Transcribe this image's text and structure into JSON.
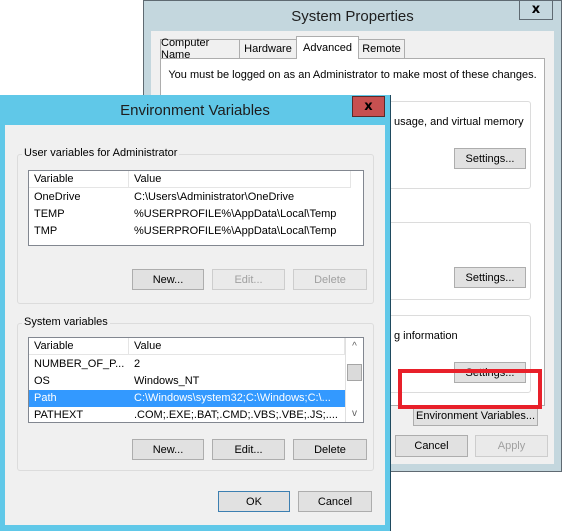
{
  "system_properties": {
    "title": "System Properties",
    "close_glyph": "x",
    "tabs": [
      {
        "label": "Computer Name",
        "active": false
      },
      {
        "label": "Hardware",
        "active": false
      },
      {
        "label": "Advanced",
        "active": true
      },
      {
        "label": "Remote",
        "active": false
      }
    ],
    "admin_note": "You must be logged on as an Administrator to make most of these changes.",
    "performance_text": "usage, and virtual memory",
    "startup_text": "g information",
    "settings_label": "Settings...",
    "env_vars_label": "Environment Variables...",
    "cancel_label": "Cancel",
    "apply_label": "Apply"
  },
  "environment_variables": {
    "title": "Environment Variables",
    "close_glyph": "x",
    "user_group_label": "User variables for Administrator",
    "columns": [
      "Variable",
      "Value"
    ],
    "user_variables": [
      {
        "variable": "OneDrive",
        "value": "C:\\Users\\Administrator\\OneDrive"
      },
      {
        "variable": "TEMP",
        "value": "%USERPROFILE%\\AppData\\Local\\Temp"
      },
      {
        "variable": "TMP",
        "value": "%USERPROFILE%\\AppData\\Local\\Temp"
      }
    ],
    "user_buttons": {
      "new": "New...",
      "edit": "Edit...",
      "delete": "Delete"
    },
    "system_group_label": "System variables",
    "system_variables": [
      {
        "variable": "NUMBER_OF_P...",
        "value": "2",
        "selected": false
      },
      {
        "variable": "OS",
        "value": "Windows_NT",
        "selected": false
      },
      {
        "variable": "Path",
        "value": "C:\\Windows\\system32;C:\\Windows;C:\\...",
        "selected": true
      },
      {
        "variable": "PATHEXT",
        "value": ".COM;.EXE;.BAT;.CMD;.VBS;.VBE;.JS;....",
        "selected": false
      }
    ],
    "system_buttons": {
      "new": "New...",
      "edit": "Edit...",
      "delete": "Delete"
    },
    "ok_label": "OK",
    "cancel_label": "Cancel"
  },
  "annotation": {
    "highlight_color": "#e8202a",
    "highlighted_target": "Environment Variables..."
  },
  "icons": {
    "scroll_up": "^",
    "scroll_down": "v"
  }
}
